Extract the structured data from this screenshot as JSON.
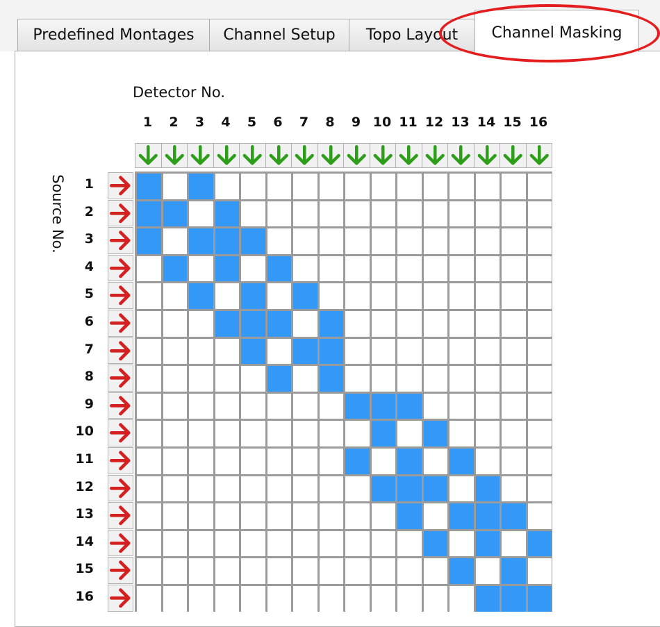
{
  "tabs": [
    {
      "label": "Predefined Montages",
      "active": false
    },
    {
      "label": "Channel Setup",
      "active": false
    },
    {
      "label": "Topo Layout",
      "active": false
    },
    {
      "label": "Channel Masking",
      "active": true
    }
  ],
  "matrix": {
    "detector_title": "Detector No.",
    "source_title": "Source No.",
    "detectors": [
      "1",
      "2",
      "3",
      "4",
      "5",
      "6",
      "7",
      "8",
      "9",
      "10",
      "11",
      "12",
      "13",
      "14",
      "15",
      "16"
    ],
    "sources": [
      "1",
      "2",
      "3",
      "4",
      "5",
      "6",
      "7",
      "8",
      "9",
      "10",
      "11",
      "12",
      "13",
      "14",
      "15",
      "16"
    ],
    "detector_button_icon": "down-arrow-icon",
    "source_button_icon": "right-arrow-icon",
    "colors": {
      "enabled": "#3498f7",
      "disabled": "#ffffff",
      "grid": "#9b9b9b",
      "down_arrow": "#2e9e1a",
      "right_arrow": "#d42020",
      "highlight": "#e41e1e"
    },
    "enabled": [
      [
        1,
        0,
        1,
        0,
        0,
        0,
        0,
        0,
        0,
        0,
        0,
        0,
        0,
        0,
        0,
        0
      ],
      [
        1,
        1,
        0,
        1,
        0,
        0,
        0,
        0,
        0,
        0,
        0,
        0,
        0,
        0,
        0,
        0
      ],
      [
        1,
        0,
        1,
        1,
        1,
        0,
        0,
        0,
        0,
        0,
        0,
        0,
        0,
        0,
        0,
        0
      ],
      [
        0,
        1,
        0,
        1,
        0,
        1,
        0,
        0,
        0,
        0,
        0,
        0,
        0,
        0,
        0,
        0
      ],
      [
        0,
        0,
        1,
        0,
        1,
        0,
        1,
        0,
        0,
        0,
        0,
        0,
        0,
        0,
        0,
        0
      ],
      [
        0,
        0,
        0,
        1,
        1,
        1,
        0,
        1,
        0,
        0,
        0,
        0,
        0,
        0,
        0,
        0
      ],
      [
        0,
        0,
        0,
        0,
        1,
        0,
        1,
        1,
        0,
        0,
        0,
        0,
        0,
        0,
        0,
        0
      ],
      [
        0,
        0,
        0,
        0,
        0,
        1,
        0,
        1,
        0,
        0,
        0,
        0,
        0,
        0,
        0,
        0
      ],
      [
        0,
        0,
        0,
        0,
        0,
        0,
        0,
        0,
        1,
        1,
        1,
        0,
        0,
        0,
        0,
        0
      ],
      [
        0,
        0,
        0,
        0,
        0,
        0,
        0,
        0,
        0,
        1,
        0,
        1,
        0,
        0,
        0,
        0
      ],
      [
        0,
        0,
        0,
        0,
        0,
        0,
        0,
        0,
        1,
        0,
        1,
        0,
        1,
        0,
        0,
        0
      ],
      [
        0,
        0,
        0,
        0,
        0,
        0,
        0,
        0,
        0,
        1,
        1,
        1,
        0,
        1,
        0,
        0
      ],
      [
        0,
        0,
        0,
        0,
        0,
        0,
        0,
        0,
        0,
        0,
        1,
        0,
        1,
        1,
        1,
        0
      ],
      [
        0,
        0,
        0,
        0,
        0,
        0,
        0,
        0,
        0,
        0,
        0,
        1,
        0,
        1,
        0,
        1
      ],
      [
        0,
        0,
        0,
        0,
        0,
        0,
        0,
        0,
        0,
        0,
        0,
        0,
        1,
        0,
        1,
        0
      ],
      [
        0,
        0,
        0,
        0,
        0,
        0,
        0,
        0,
        0,
        0,
        0,
        0,
        0,
        1,
        1,
        1
      ]
    ]
  }
}
